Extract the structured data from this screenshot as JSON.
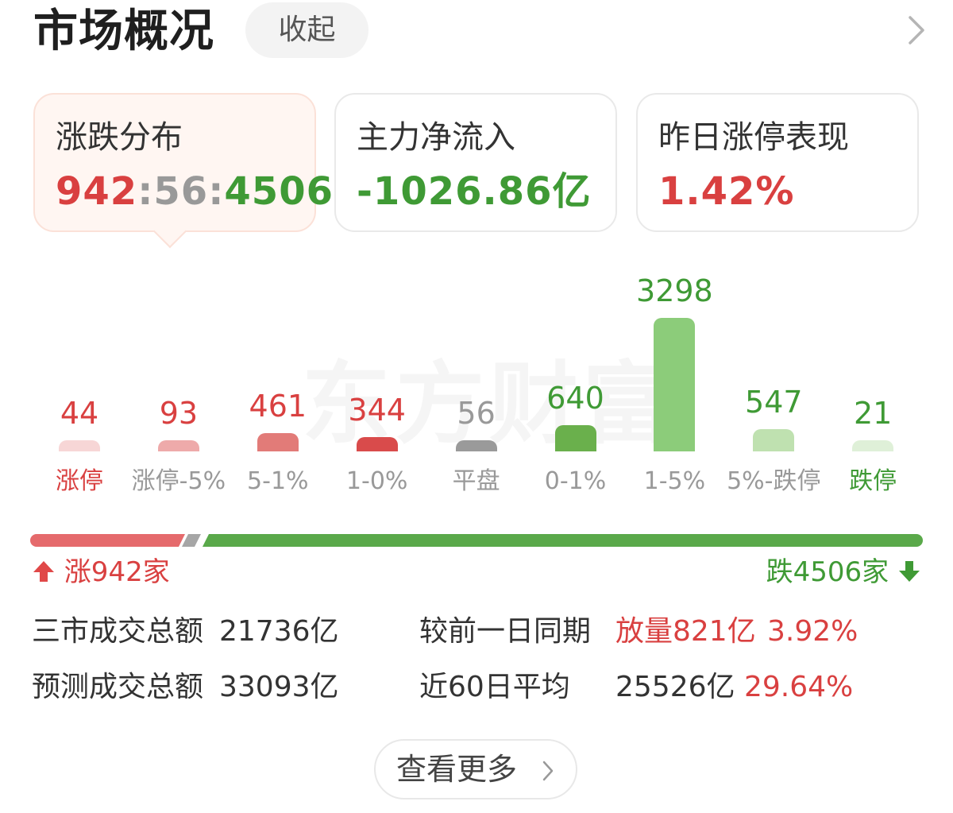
{
  "header": {
    "title": "市场概况",
    "collapse_label": "收起",
    "arrow_icon": "chevron-right-icon"
  },
  "cards": {
    "distribution": {
      "title": "涨跌分布",
      "up": "942",
      "sep1": ":",
      "flat": "56",
      "sep2": ":",
      "down": "4506"
    },
    "net_inflow": {
      "title": "主力净流入",
      "value": "-1026.86亿"
    },
    "limit_up": {
      "title": "昨日涨停表现",
      "value": "1.42%"
    }
  },
  "watermark": "东方财富",
  "chart_data": {
    "type": "bar",
    "categories": [
      "涨停",
      "涨停-5%",
      "5-1%",
      "1-0%",
      "平盘",
      "0-1%",
      "1-5%",
      "5%-跌停",
      "跌停"
    ],
    "values": [
      44,
      93,
      461,
      344,
      56,
      640,
      3298,
      547,
      21
    ],
    "value_labels": [
      "44",
      "93",
      "461",
      "344",
      "56",
      "640",
      "3298",
      "547",
      "21"
    ],
    "colors": [
      "#f7d6d6",
      "#eeaaaa",
      "#e27b78",
      "#d94b4b",
      "#9a9a9a",
      "#6ab04c",
      "#8ccc7a",
      "#bfe1b0",
      "#dff0d8"
    ],
    "label_colors": [
      "#d94040",
      "#999999",
      "#999999",
      "#999999",
      "#999999",
      "#999999",
      "#999999",
      "#999999",
      "#3f9a35"
    ],
    "value_colors": [
      "#d94040",
      "#d94040",
      "#d94040",
      "#d94040",
      "#999999",
      "#3f9a35",
      "#3f9a35",
      "#3f9a35",
      "#3f9a35"
    ],
    "title": "",
    "xlabel": "",
    "ylabel": "",
    "grid": false
  },
  "ratio": {
    "up": 942,
    "flat": 56,
    "down": 4506,
    "up_label": "涨942家",
    "down_label": "跌4506家"
  },
  "stats": {
    "total_label": "三市成交总额",
    "total_value": "21736亿",
    "compare_label": "较前一日同期",
    "compare_value": "放量821亿",
    "compare_pct": "3.92%",
    "forecast_label": "预测成交总额",
    "forecast_value": "33093亿",
    "avg_label": "近60日平均",
    "avg_value": "25526亿",
    "avg_pct": "29.64%"
  },
  "more": {
    "label": "查看更多"
  }
}
